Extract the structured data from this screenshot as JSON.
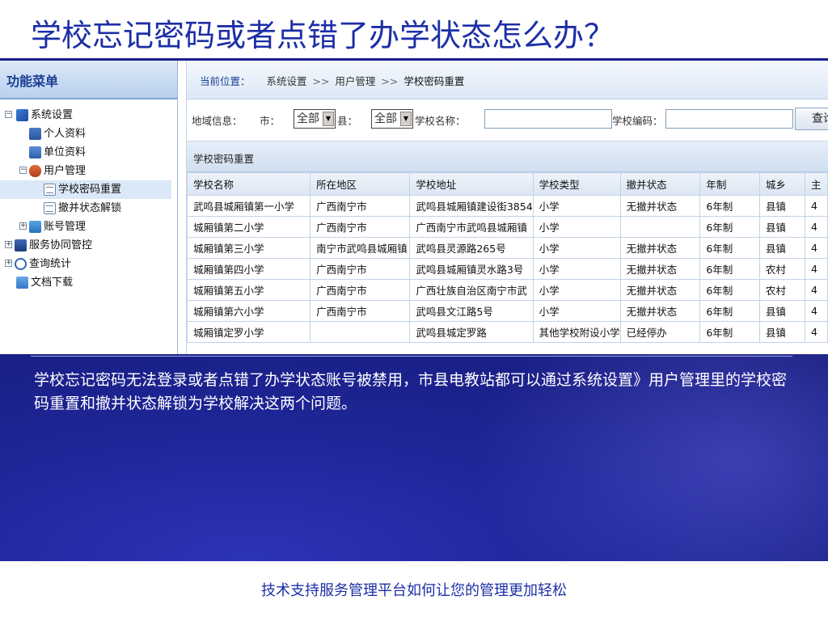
{
  "slide": {
    "title": "学校忘记密码或者点错了办学状态怎么办？",
    "description": "学校忘记密码无法登录或者点错了办学状态账号被禁用，市县电教站都可以通过系统设置》用户管理里的学校密码重置和撤并状态解锁为学校解决这两个问题。",
    "footer": "技术支持服务管理平台如何让您的管理更加轻松"
  },
  "menu": {
    "title": "功能菜单",
    "items": [
      {
        "label": "系统设置",
        "icon": "system-settings-icon",
        "toggle": "⊟"
      },
      {
        "label": "个人资料",
        "icon": "profile-icon"
      },
      {
        "label": "单位资料",
        "icon": "organization-icon"
      },
      {
        "label": "用户管理",
        "icon": "users-icon",
        "toggle": "⊟"
      },
      {
        "label": "学校密码重置",
        "icon": "document-icon",
        "selected": true
      },
      {
        "label": "撤并状态解锁",
        "icon": "document-icon"
      },
      {
        "label": "账号管理",
        "icon": "account-icon",
        "toggle": "⊞"
      },
      {
        "label": "服务协同管控",
        "icon": "service-icon",
        "toggle": "⊞"
      },
      {
        "label": "查询统计",
        "icon": "query-icon",
        "toggle": "⊞"
      },
      {
        "label": "文档下载",
        "icon": "download-icon"
      }
    ]
  },
  "breadcrumb": {
    "prefix": "当前位置：",
    "items": [
      "系统设置",
      "用户管理",
      "学校密码重置"
    ],
    "separator": ">>"
  },
  "filter": {
    "region_label": "地域信息：",
    "city_label": "市：",
    "city_value": "全部",
    "county_label": "县：",
    "county_value": "全部",
    "school_name_label": "学校名称：",
    "school_name_value": "",
    "school_code_label": "学校编码：",
    "school_code_value": "",
    "query_label": "查询"
  },
  "section": {
    "title": "学校密码重置"
  },
  "table": {
    "columns": [
      "学校名称",
      "所在地区",
      "学校地址",
      "学校类型",
      "撤并状态",
      "年制",
      "城乡",
      "主"
    ],
    "rows": [
      [
        "武鸣县城厢镇第一小学",
        "广西南宁市",
        "武鸣县城厢镇建设街3854",
        "小学",
        "无撤并状态",
        "6年制",
        "县镇",
        "4"
      ],
      [
        "城厢镇第二小学",
        "广西南宁市",
        "广西南宁市武鸣县城厢镇",
        "小学",
        "",
        "6年制",
        "县镇",
        "4"
      ],
      [
        "城厢镇第三小学",
        "南宁市武鸣县城厢镇",
        "武鸣县灵源路265号",
        "小学",
        "无撤并状态",
        "6年制",
        "县镇",
        "4"
      ],
      [
        "城厢镇第四小学",
        "广西南宁市",
        "武鸣县城厢镇灵水路3号",
        "小学",
        "无撤并状态",
        "6年制",
        "农村",
        "4"
      ],
      [
        "城厢镇第五小学",
        "广西南宁市",
        "广西壮族自治区南宁市武",
        "小学",
        "无撤并状态",
        "6年制",
        "农村",
        "4"
      ],
      [
        "城厢镇第六小学",
        "广西南宁市",
        "武鸣县文江路5号",
        "小学",
        "无撤并状态",
        "6年制",
        "县镇",
        "4"
      ],
      [
        "城厢镇定罗小学",
        "",
        "武鸣县城定罗路",
        "其他学校附设小学",
        "已经停办",
        "6年制",
        "县镇",
        "4"
      ]
    ]
  },
  "colors": {
    "title": "#1c2fa6",
    "background_blue": "#1e2597",
    "menu_header": "#1b3f92"
  }
}
